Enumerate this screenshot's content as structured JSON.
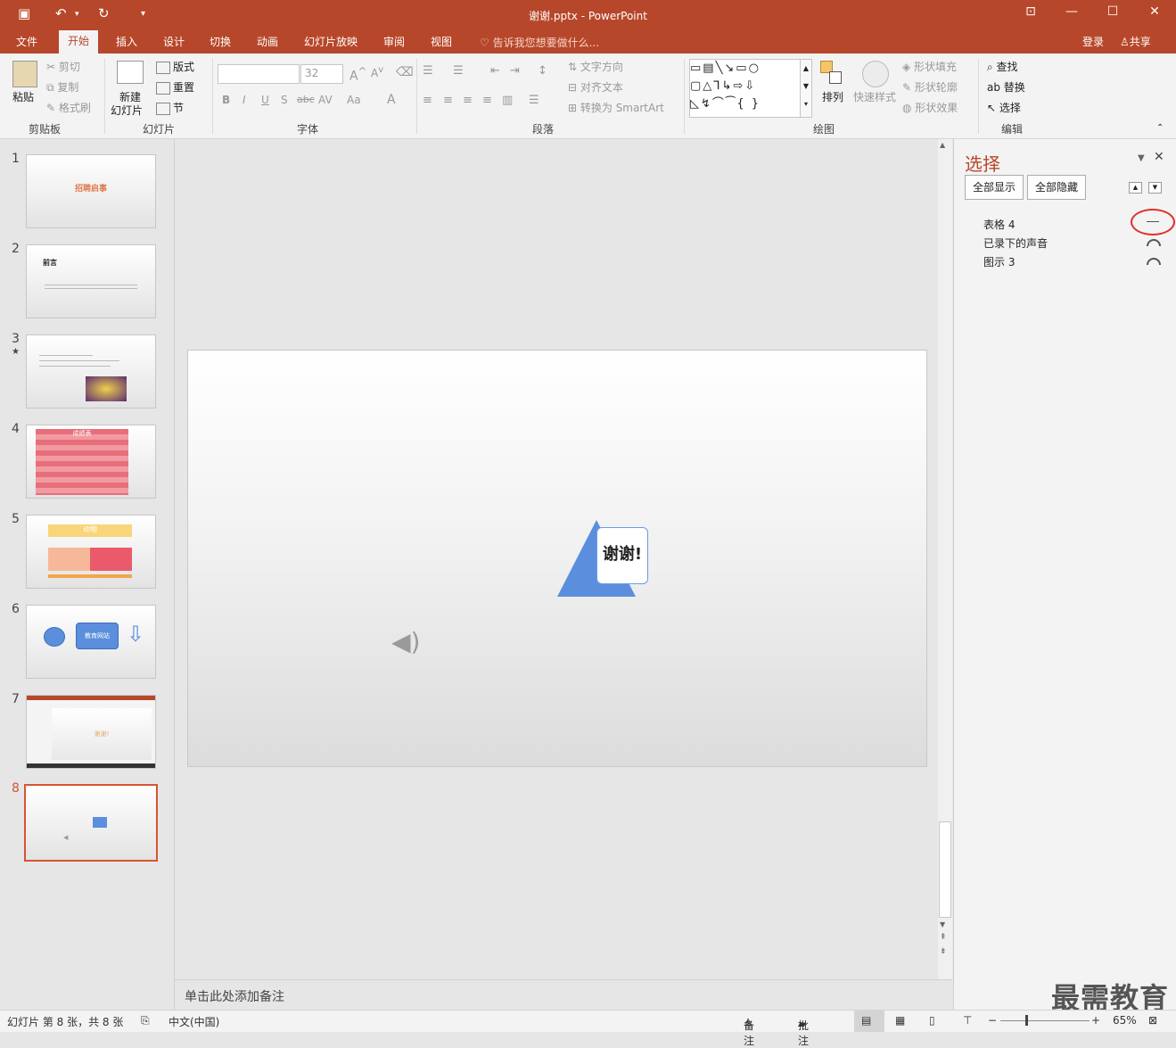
{
  "window": {
    "title": "谢谢.pptx - PowerPoint"
  },
  "tabs": [
    "文件",
    "开始",
    "插入",
    "设计",
    "切换",
    "动画",
    "幻灯片放映",
    "审阅",
    "视图"
  ],
  "active_tab": "开始",
  "tellme": "告诉我您想要做什么...",
  "account": {
    "login": "登录",
    "share": "共享"
  },
  "clipboard": {
    "paste": "粘贴",
    "cut": "剪切",
    "copy": "复制",
    "painter": "格式刷",
    "label": "剪贴板"
  },
  "slides_group": {
    "new": "新建",
    "new2": "幻灯片",
    "layout": "版式",
    "reset": "重置",
    "section": "节",
    "label": "幻灯片"
  },
  "font_group": {
    "size": "32",
    "label": "字体"
  },
  "paragraph": {
    "direction": "文字方向",
    "align": "对齐文本",
    "smartart": "转换为 SmartArt",
    "label": "段落"
  },
  "drawing": {
    "arrange": "排列",
    "quickstyle": "快速样式",
    "fill": "形状填充",
    "outline": "形状轮廓",
    "effect": "形状效果",
    "label": "绘图"
  },
  "editing": {
    "find": "查找",
    "replace": "替换",
    "select": "选择",
    "label": "编辑"
  },
  "thumbs": [
    {
      "n": "1",
      "text": "招聘启事"
    },
    {
      "n": "2",
      "text": "前言"
    },
    {
      "n": "3",
      "text": ""
    },
    {
      "n": "4",
      "text": "成绩表"
    },
    {
      "n": "5",
      "text": "动物"
    },
    {
      "n": "6",
      "text": "教育网站"
    },
    {
      "n": "7",
      "text": "谢谢!"
    },
    {
      "n": "8",
      "text": ""
    }
  ],
  "slide": {
    "text": "谢谢!"
  },
  "notes_placeholder": "单击此处添加备注",
  "pane": {
    "title": "选择",
    "show_all": "全部显示",
    "hide_all": "全部隐藏",
    "items": [
      "表格 4",
      "已录下的声音",
      "图示 3"
    ]
  },
  "status": {
    "slide_info": "幻灯片 第 8 张，共 8 张",
    "lang": "中文(中国)",
    "notes": "备注",
    "comments": "批注",
    "zoom": "65%"
  },
  "watermark": "最需教育",
  "colors": {
    "accent": "#b7472a",
    "shape": "#5b8fdd"
  }
}
